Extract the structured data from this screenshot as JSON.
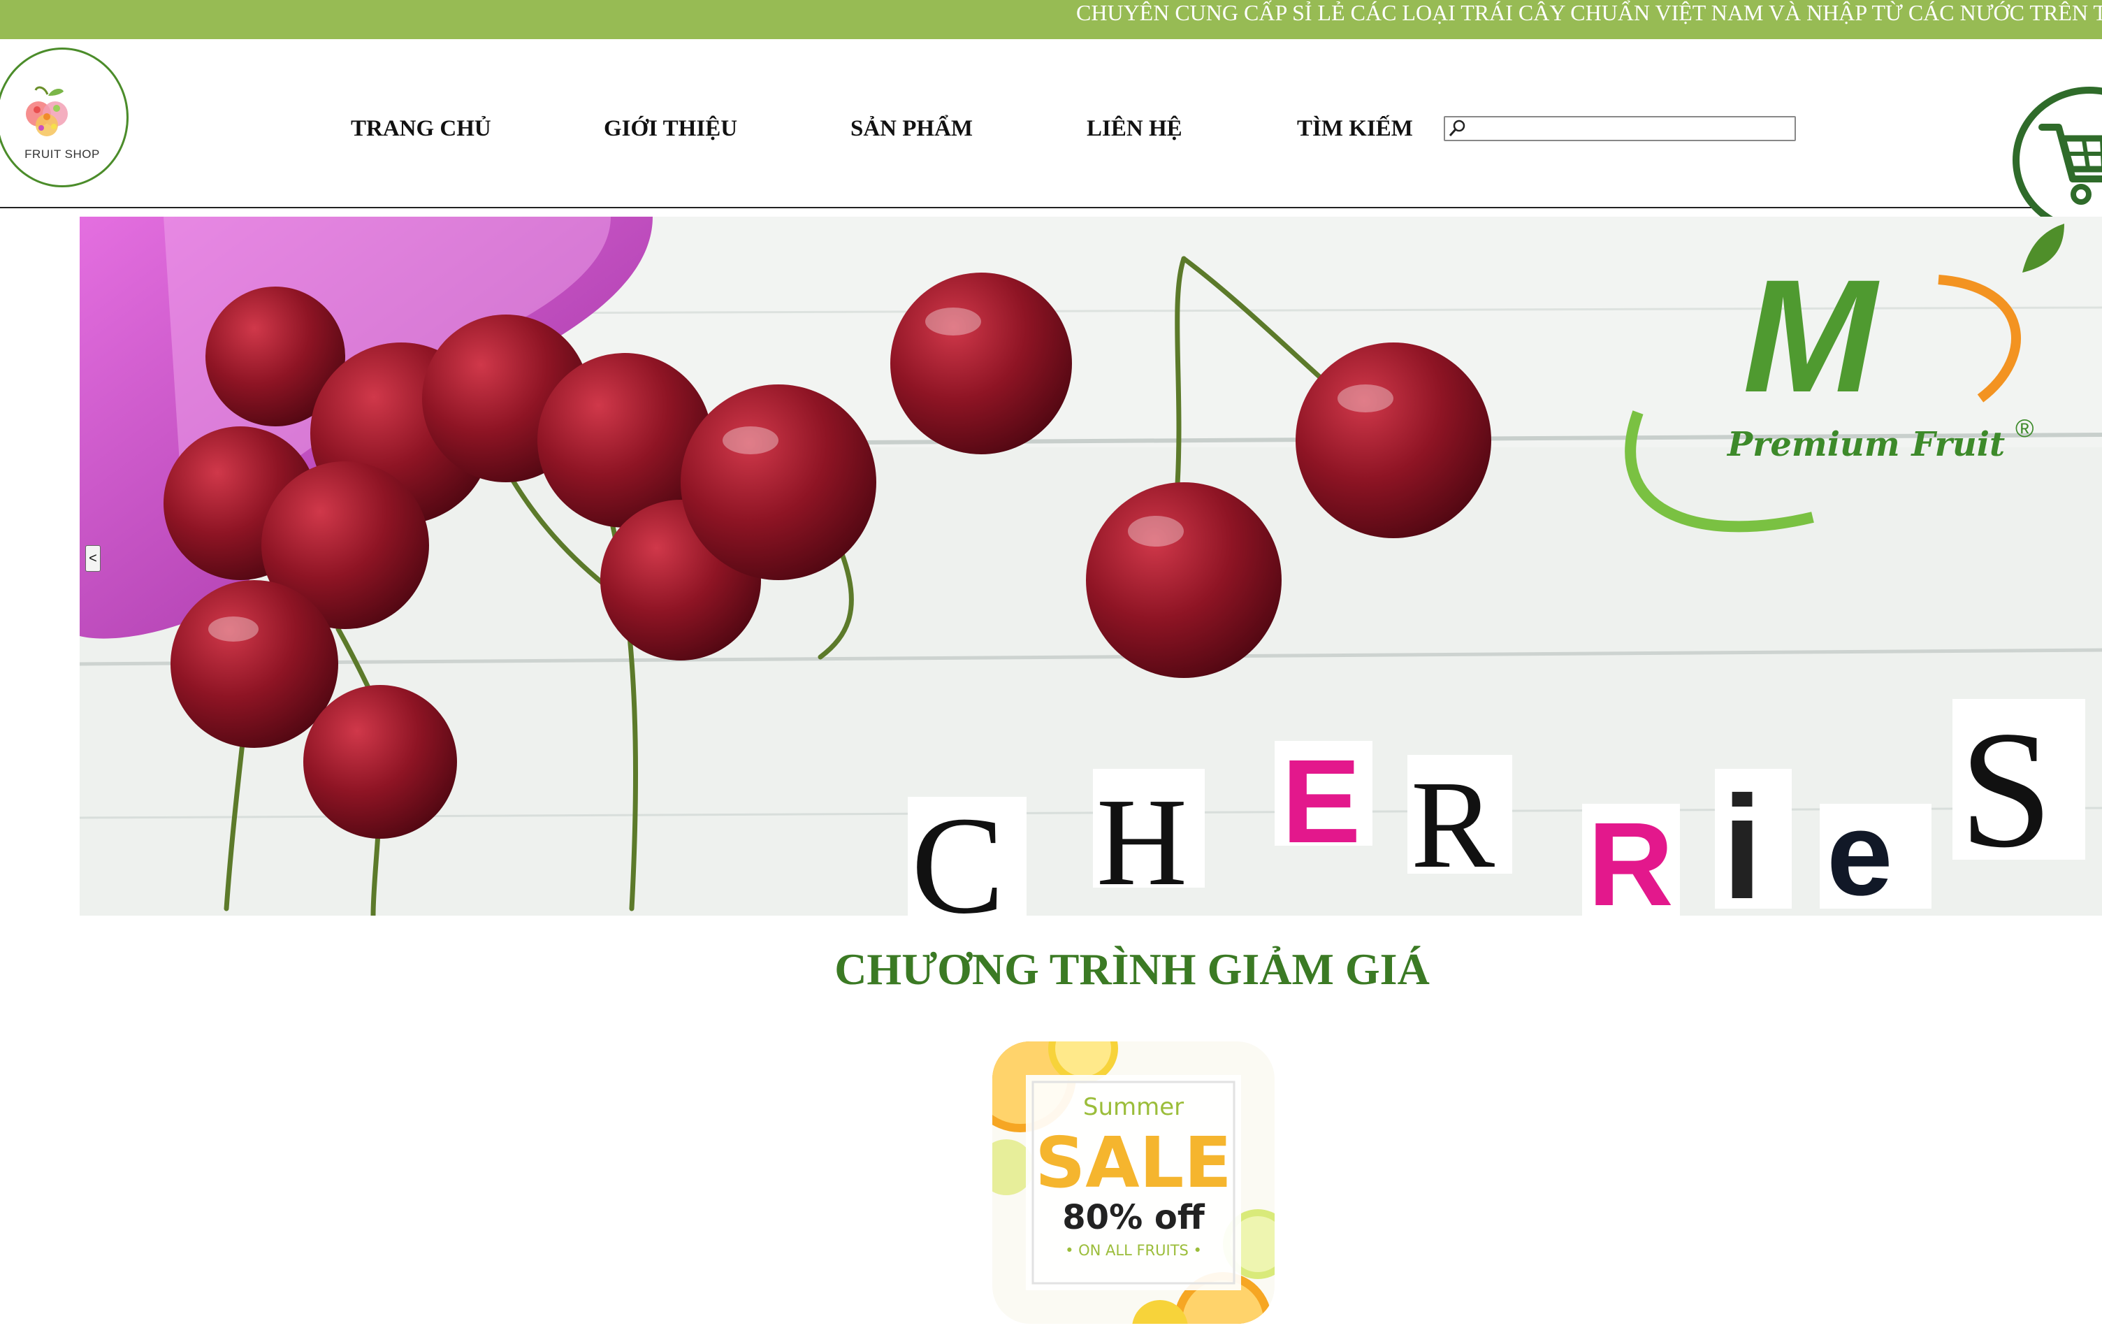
{
  "topbar": {
    "marquee": "CHUYÊN CUNG CẤP SỈ LẺ CÁC LOẠI TRÁI CÂY CHUẨN VIỆT NAM VÀ NHẬP TỪ CÁC NƯỚC TRÊN THẾ GIỚI"
  },
  "logo": {
    "text": "FRUIT SHOP"
  },
  "nav": {
    "home": "TRANG CHỦ",
    "about": "GIỚI THIỆU",
    "products": "SẢN PHẨM",
    "contact": "LIÊN HỆ",
    "search": "TÌM KIẾM"
  },
  "search": {
    "value": "",
    "placeholder": ""
  },
  "banner": {
    "brand_letter": "M",
    "brand_name": "Premium Fruit",
    "registered": "®",
    "word_letters": [
      "C",
      "H",
      "E",
      "R",
      "R",
      "i",
      "e",
      "S"
    ],
    "prev_label": "<"
  },
  "promo": {
    "title": "CHƯƠNG TRÌNH GIẢM GIÁ",
    "summer": "Summer",
    "sale": "SALE",
    "discount": "80% off",
    "subtitle": "• ON ALL FRUITS •"
  },
  "colors": {
    "topbar": "#97bb54",
    "title_green": "#3b7a24",
    "cart_green": "#2f6b2a"
  },
  "icons": [
    "apple-logo-icon",
    "search-icon",
    "shopping-cart-icon"
  ]
}
